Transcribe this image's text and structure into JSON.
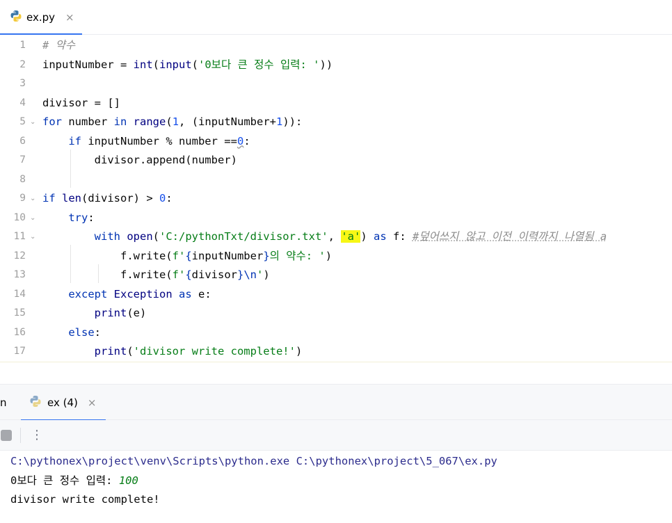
{
  "editor_tab": {
    "label": "ex.py",
    "close": "×",
    "icon": "python-icon"
  },
  "code": {
    "l1": {
      "n": "1",
      "comment": "# 약수"
    },
    "l2": {
      "n": "2",
      "a": "inputNumber = ",
      "int": "int",
      "p1": "(",
      "input": "input",
      "p2": "(",
      "str": "'0보다 큰 정수 입력: '",
      "p3": "))"
    },
    "l3": {
      "n": "3"
    },
    "l4": {
      "n": "4",
      "text": "divisor = []"
    },
    "l5": {
      "n": "5",
      "for": "for",
      "a": " number ",
      "in": "in",
      "b": " ",
      "range": "range",
      "c": "(",
      "one": "1",
      "d": ", (inputNumber+",
      "one2": "1",
      "e": ")):"
    },
    "l6": {
      "n": "6",
      "if": "if",
      "a": " inputNumber % number ==",
      "zero": "0",
      "b": ":"
    },
    "l7": {
      "n": "7",
      "text": "divisor.append(number)"
    },
    "l8": {
      "n": "8"
    },
    "l9": {
      "n": "9",
      "if": "if",
      "b": " ",
      "len": "len",
      "c": "(divisor) > ",
      "zero": "0",
      "d": ":"
    },
    "l10": {
      "n": "10",
      "try": "try",
      "a": ":"
    },
    "l11": {
      "n": "11",
      "with": "with",
      "b": " ",
      "open": "open",
      "c": "(",
      "path": "'C:/pythonTxt/divisor.txt'",
      "d": ", ",
      "mode": "'a'",
      "e": ") ",
      "as": "as",
      "f": " f: ",
      "comment": "#덮어쓰지 않고 이전 이력까지 나열됨 a"
    },
    "l12": {
      "n": "12",
      "a": "f.write(",
      "fs": "f'",
      "brace1": "{",
      "var": "inputNumber",
      "brace2": "}",
      "rest": "의 약수: '",
      "close": ")"
    },
    "l13": {
      "n": "13",
      "a": "f.write(",
      "fs": "f'",
      "brace1": "{",
      "var": "divisor",
      "brace2": "}",
      "esc": "\\n",
      "q": "'",
      "close": ")"
    },
    "l14": {
      "n": "14",
      "except": "except",
      "b": " ",
      "exc": "Exception",
      "c": " ",
      "as": "as",
      "d": " e:"
    },
    "l15": {
      "n": "15",
      "print": "print",
      "a": "(e)"
    },
    "l16": {
      "n": "16",
      "else": "else",
      "a": ":"
    },
    "l17": {
      "n": "17",
      "print": "print",
      "a": "(",
      "str": "'divisor write complete!'",
      "b": ")"
    }
  },
  "run": {
    "prev_tab_label": "n",
    "tab_label": "ex (4)",
    "tab_close": "×",
    "more": "⋮"
  },
  "console": {
    "command": "C:\\pythonex\\project\\venv\\Scripts\\python.exe C:\\pythonex\\project\\5_067\\ex.py",
    "prompt": "0보다 큰 정수 입력: ",
    "input_value": "100",
    "output": "divisor write complete!"
  },
  "colors": {
    "accent": "#3574f0",
    "keyword": "#0033b3",
    "string": "#067d17",
    "number": "#1750eb",
    "comment": "#8c8c8c",
    "highlight": "#f7f716"
  }
}
